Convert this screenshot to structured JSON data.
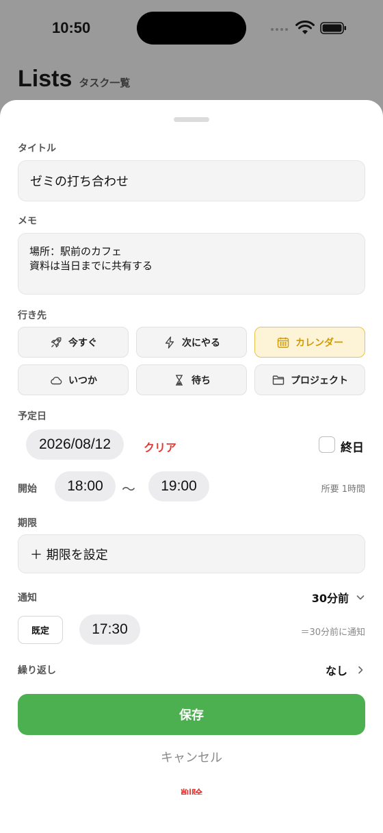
{
  "status_bar": {
    "time": "10:50"
  },
  "background": {
    "title": "Lists",
    "subtitle": "タスク一覧"
  },
  "form": {
    "title_label": "タイトル",
    "title_value": "ゼミの打ち合わせ",
    "memo_label": "メモ",
    "memo_lines": [
      "場所：駅前のカフェ",
      "資料は当日までに共有する"
    ],
    "destination_label": "行き先",
    "destinations": [
      {
        "label": "今すぐ",
        "icon": "rocket-icon",
        "selected": false
      },
      {
        "label": "次にやる",
        "icon": "bolt-icon",
        "selected": false
      },
      {
        "label": "カレンダー",
        "icon": "calendar-icon",
        "selected": true
      },
      {
        "label": "いつか",
        "icon": "cloud-icon",
        "selected": false
      },
      {
        "label": "待ち",
        "icon": "hourglass-icon",
        "selected": false
      },
      {
        "label": "プロジェクト",
        "icon": "folder-icon",
        "selected": false
      }
    ],
    "scheduled_label": "予定日",
    "scheduled_date": "2026/08/12",
    "clear_label": "クリア",
    "all_day_label": "終日",
    "all_day_checked": false,
    "start_label": "開始",
    "start_time": "18:00",
    "tilde": "〜",
    "end_time": "19:00",
    "duration_text": "所要 1時間",
    "deadline_label": "期限",
    "deadline_button": "＋ 期限を設定",
    "notify_label": "通知",
    "notify_value": "30分前",
    "default_chip": "既定",
    "notify_time": "17:30",
    "notify_note": "＝30分前に通知",
    "repeat_label": "繰り返し",
    "repeat_value": "なし",
    "save_label": "保存",
    "cancel_label": "キャンセル",
    "delete_label": "削除"
  },
  "colors": {
    "accent_green": "#4caf50",
    "accent_red": "#e53935",
    "selected_yellow": "#d19a00"
  }
}
